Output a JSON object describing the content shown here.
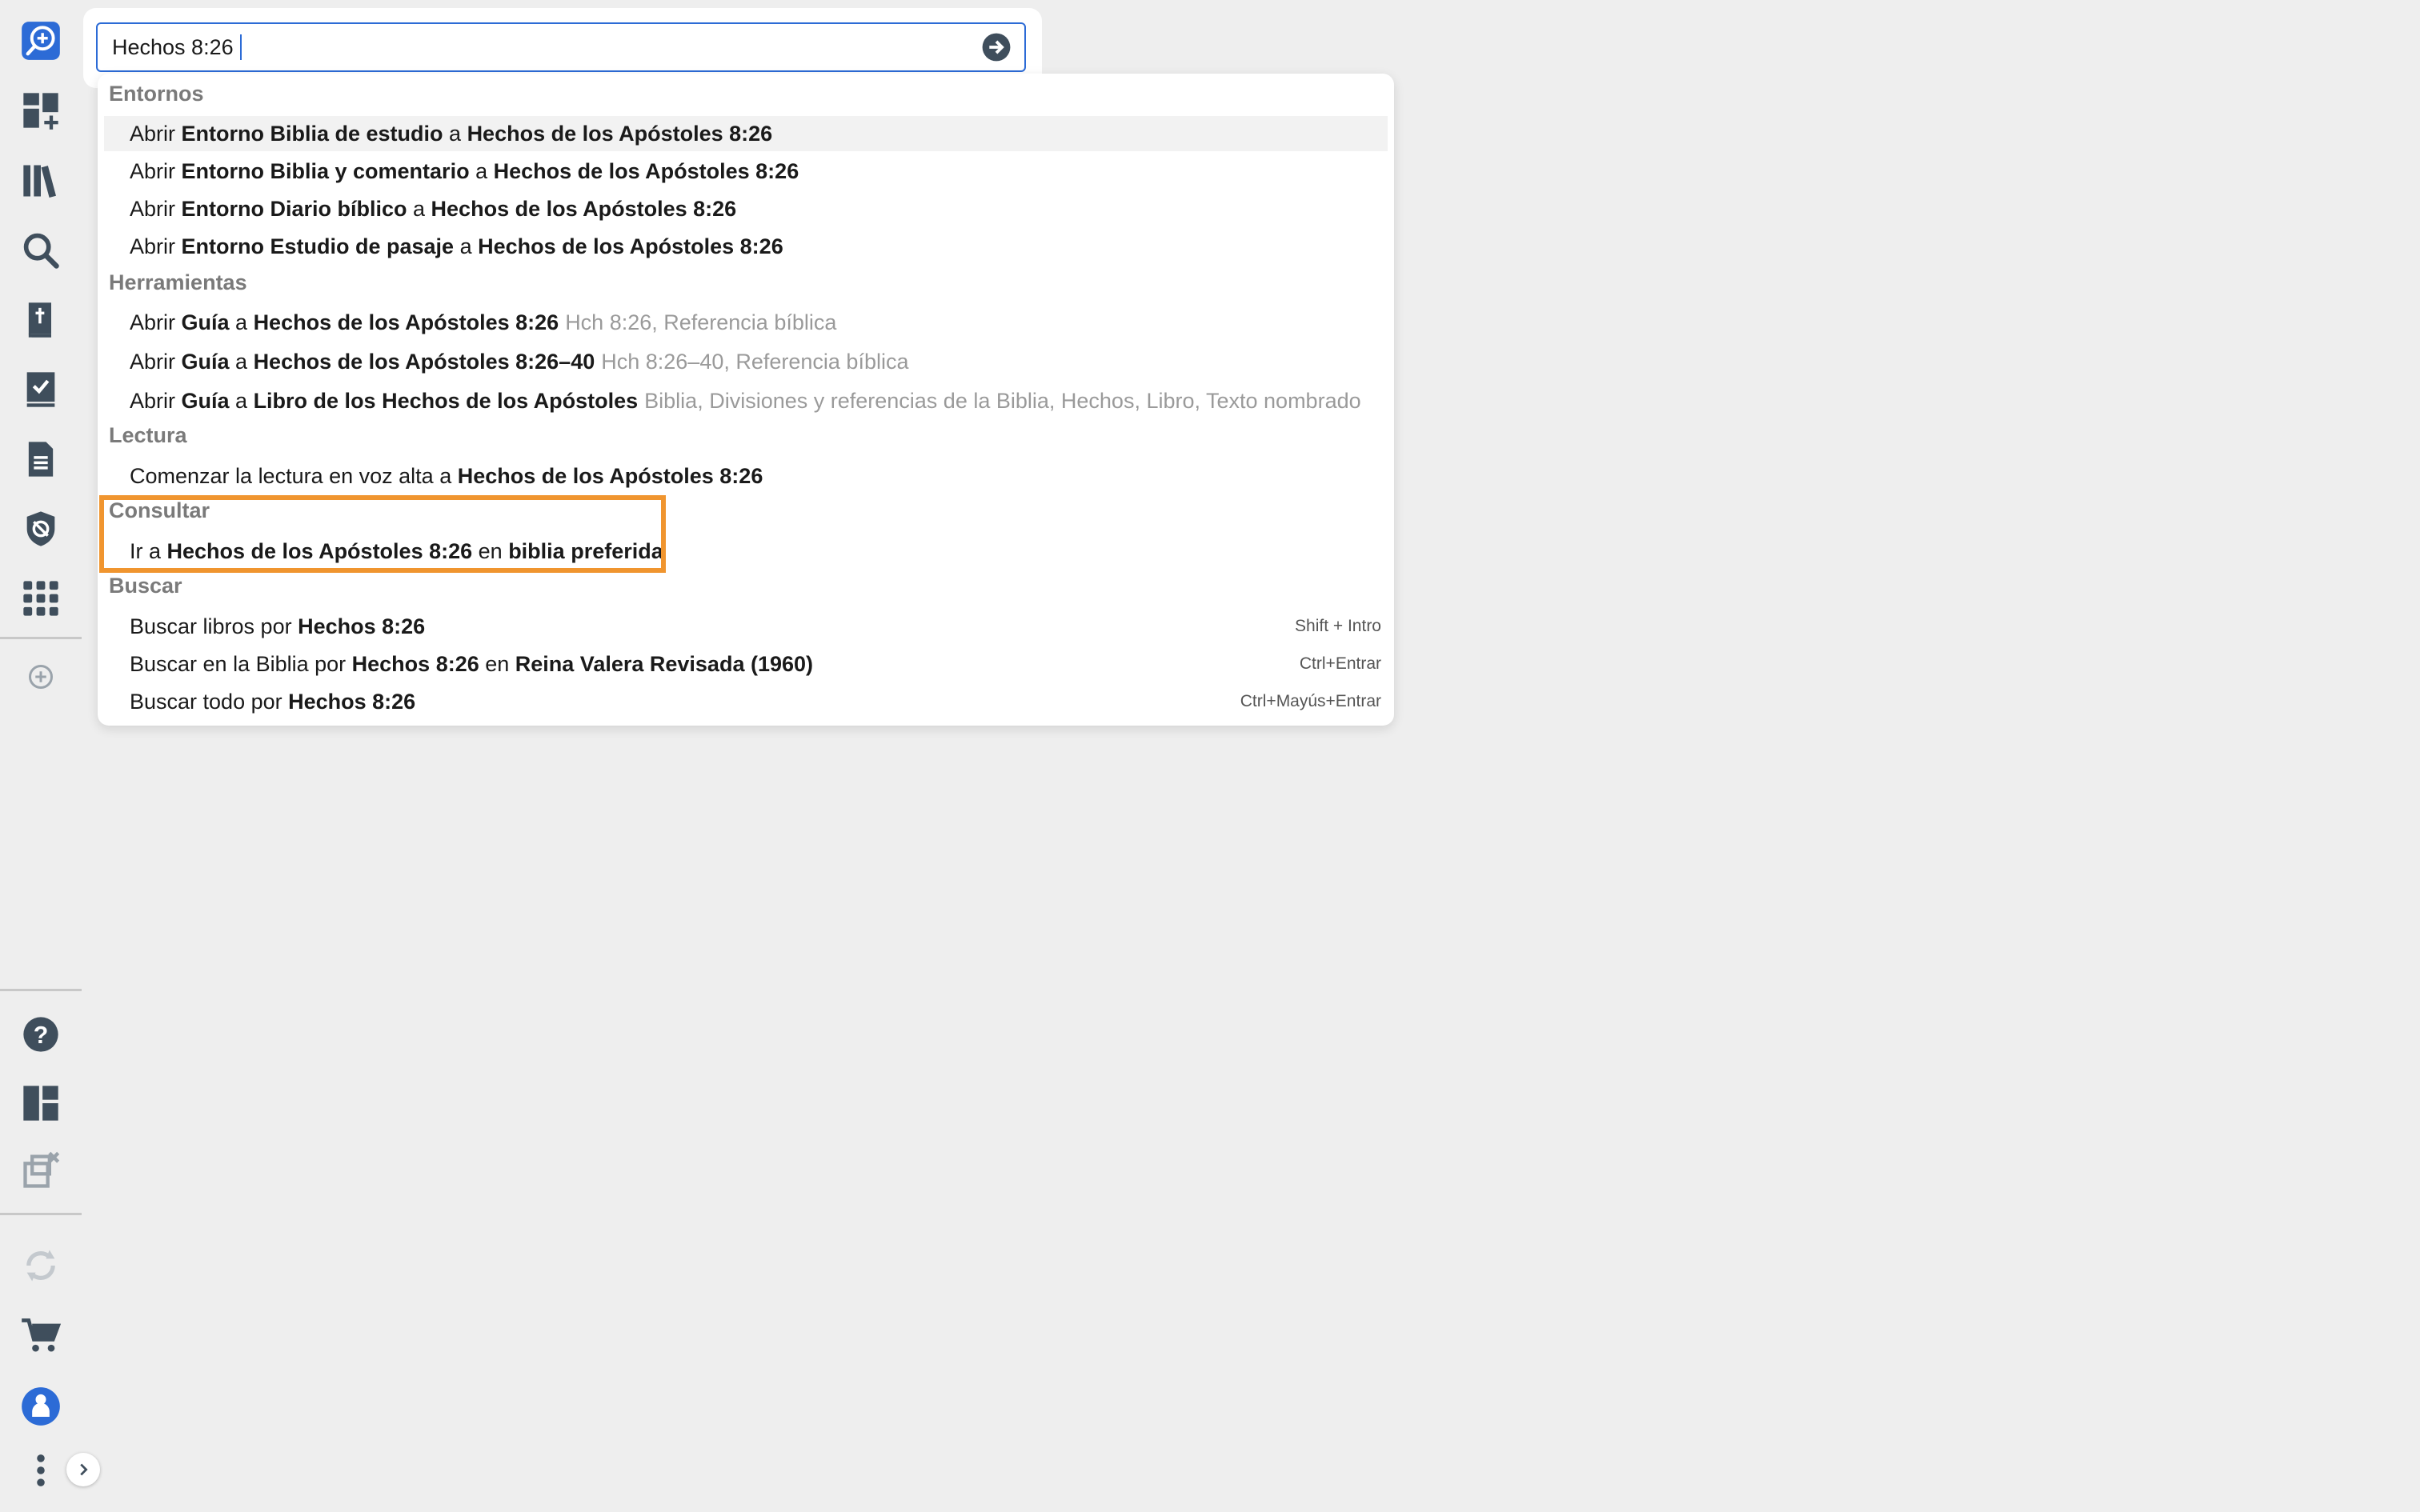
{
  "search": {
    "value": "Hechos 8:26",
    "go_label": "Ir"
  },
  "sidebar": {
    "items": [
      {
        "name": "search-add-icon",
        "color": "#2c6bd6"
      },
      {
        "name": "dashboard-add-icon"
      },
      {
        "name": "library-icon"
      },
      {
        "name": "search-icon"
      },
      {
        "name": "bible-icon"
      },
      {
        "name": "checklist-icon"
      },
      {
        "name": "document-icon"
      },
      {
        "name": "shield-icon"
      },
      {
        "name": "apps-grid-icon"
      },
      {
        "name": "add-circle-icon"
      },
      {
        "name": "help-icon"
      },
      {
        "name": "layout-icon"
      },
      {
        "name": "close-layouts-icon"
      },
      {
        "name": "sync-icon"
      },
      {
        "name": "cart-icon"
      },
      {
        "name": "user-avatar-icon",
        "color": "#2c6bd6"
      },
      {
        "name": "more-vertical-icon"
      },
      {
        "name": "chevron-right-icon"
      }
    ]
  },
  "dropdown": {
    "sections": {
      "entornos": "Entornos",
      "herramientas": "Herramientas",
      "lectura": "Lectura",
      "consultar": "Consultar",
      "buscar": "Buscar"
    },
    "entornos": [
      {
        "pre": "Abrir ",
        "b1": "Entorno Biblia de estudio",
        "mid": " a ",
        "b2": "Hechos de los Apóstoles 8:26"
      },
      {
        "pre": "Abrir ",
        "b1": "Entorno Biblia y comentario",
        "mid": " a ",
        "b2": "Hechos de los Apóstoles 8:26"
      },
      {
        "pre": "Abrir ",
        "b1": "Entorno Diario bíblico",
        "mid": " a ",
        "b2": "Hechos de los Apóstoles 8:26"
      },
      {
        "pre": "Abrir ",
        "b1": "Entorno Estudio de pasaje",
        "mid": " a ",
        "b2": "Hechos de los Apóstoles 8:26"
      }
    ],
    "herramientas": [
      {
        "pre": "Abrir ",
        "b1": "Guía",
        "mid": " a ",
        "b2": "Hechos de los Apóstoles 8:26",
        "hint": "Hch 8:26, Referencia bíblica"
      },
      {
        "pre": "Abrir ",
        "b1": "Guía",
        "mid": " a ",
        "b2": "Hechos de los Apóstoles 8:26–40",
        "hint": "Hch 8:26–40, Referencia bíblica"
      },
      {
        "pre": "Abrir ",
        "b1": "Guía",
        "mid": " a ",
        "b2": "Libro de los Hechos de los Apóstoles",
        "hint": "Biblia, Divisiones y referencias de la Biblia, Hechos, Libro, Texto nombrado"
      }
    ],
    "lectura": [
      {
        "pre": "Comenzar la lectura en voz alta a ",
        "b1": "Hechos de los Apóstoles 8:26"
      }
    ],
    "consultar": [
      {
        "pre": "Ir a ",
        "b1": "Hechos de los Apóstoles 8:26",
        "mid": " en ",
        "b2": "biblia preferida"
      }
    ],
    "buscar": [
      {
        "pre": "Buscar libros por ",
        "b1": "Hechos 8:26",
        "kbd": "Shift + Intro"
      },
      {
        "pre": "Buscar en la Biblia por ",
        "b1": "Hechos 8:26",
        "mid": " en ",
        "b2": "Reina Valera Revisada (1960)",
        "kbd": "Ctrl+Entrar"
      },
      {
        "pre": "Buscar todo por ",
        "b1": "Hechos 8:26",
        "kbd": "Ctrl+Mayús+Entrar"
      }
    ]
  },
  "colors": {
    "accent": "#2c6bd6",
    "highlight_box": "#f0952f",
    "icon": "#3f4e5c",
    "icon_disabled": "#9aa3ab"
  }
}
